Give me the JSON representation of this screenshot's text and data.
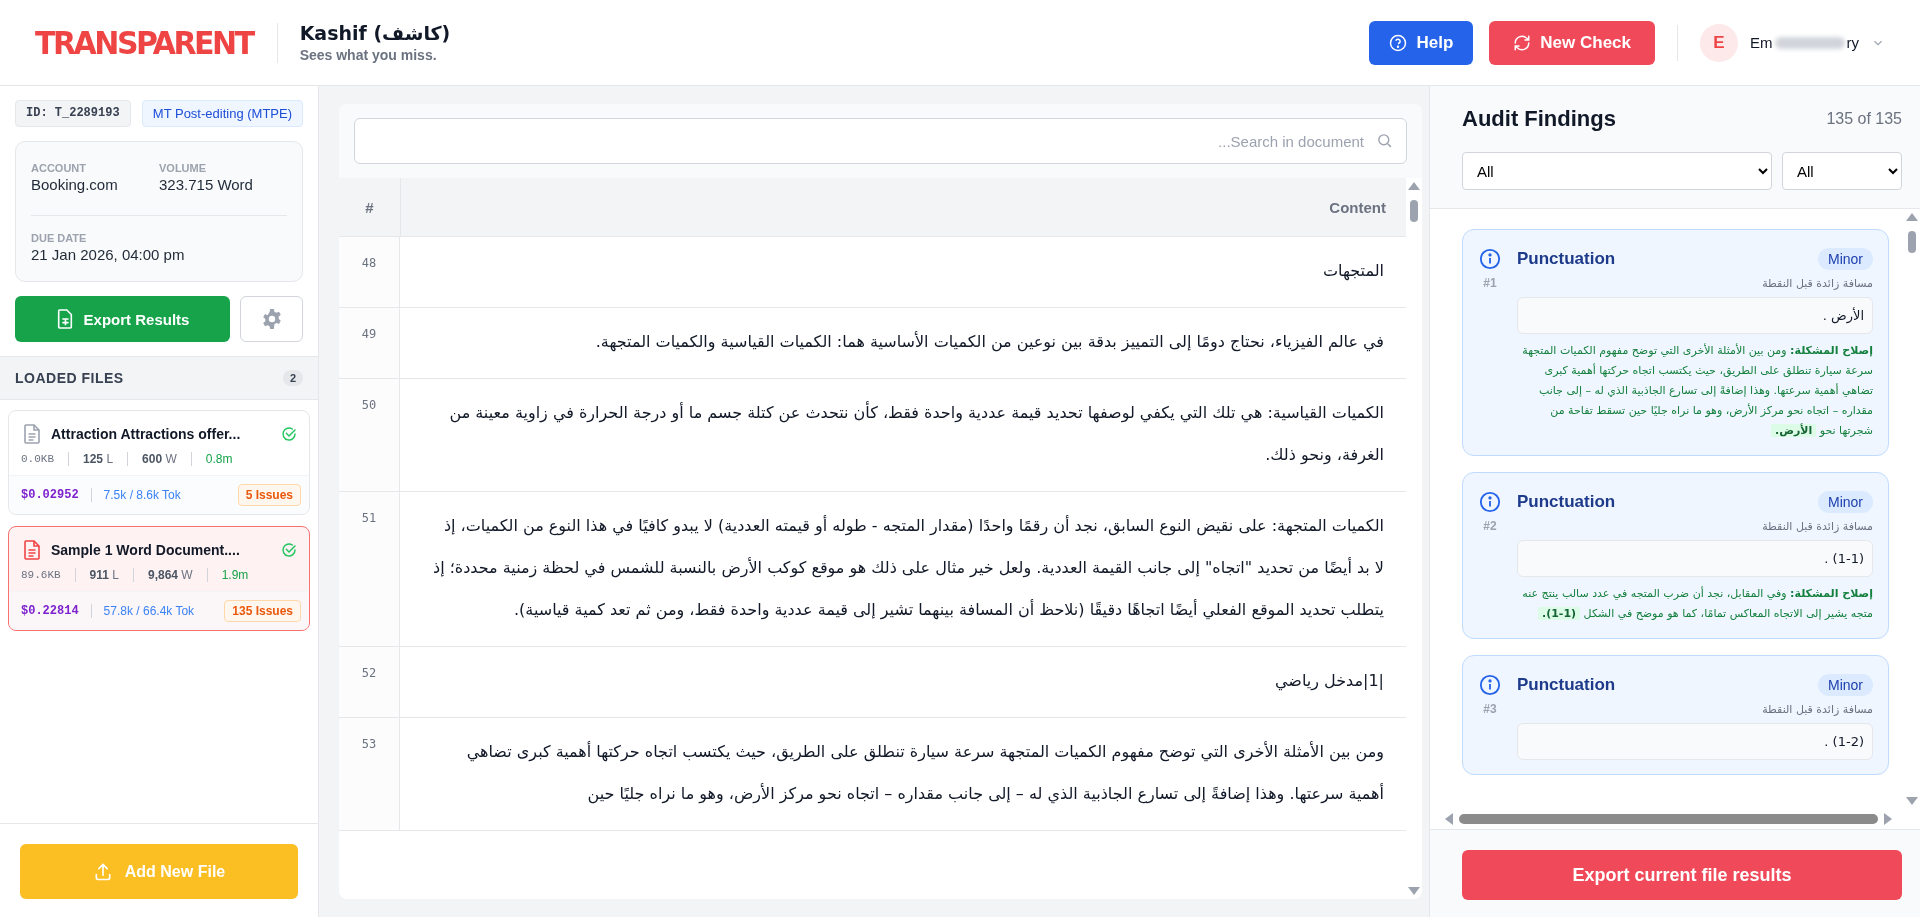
{
  "header": {
    "logo": "TRANSPARENT",
    "app_name": "Kashif (كاشف)",
    "tagline": "Sees what you miss.",
    "help_button": "Help",
    "new_check_button": "New Check",
    "user": {
      "initial": "E",
      "name_start": "Em",
      "name_end": "ry"
    }
  },
  "sidebar": {
    "id_tag": "ID: T_2289193",
    "mode_tag": "MT Post-editing (MTPE)",
    "account": {
      "label": "ACCOUNT",
      "value": "Booking.com"
    },
    "volume": {
      "label": "VOLUME",
      "value": "323.715 Word"
    },
    "due_date": {
      "label": "DUE DATE",
      "value": "21 Jan 2026, 04:00 pm"
    },
    "export_button": "Export Results",
    "files_heading": "LOADED FILES",
    "files_count": "2",
    "files": [
      {
        "name": "Attraction Attractions offer...",
        "selected": false,
        "complete": true,
        "size": "0.0KB",
        "lines": "125",
        "lines_unit": "L",
        "words": "600",
        "words_unit": "W",
        "time": "0.8m",
        "cost": "$0.02952",
        "tokens": "7.5k / 8.6k Tok",
        "issues": "5 Issues"
      },
      {
        "name": "Sample 1 Word Document....",
        "selected": true,
        "complete": true,
        "size": "89.6KB",
        "lines": "911",
        "lines_unit": "L",
        "words": "9,864",
        "words_unit": "W",
        "time": "1.9m",
        "cost": "$0.22814",
        "tokens": "57.8k / 66.4k Tok",
        "issues": "135 Issues"
      }
    ],
    "add_button": "Add New File"
  },
  "document": {
    "search": {
      "placeholder": "Search in document..."
    },
    "number_column": "#",
    "content_column": "Content",
    "rows": [
      {
        "number": "48",
        "text": "المتجهات"
      },
      {
        "number": "49",
        "text": "في عالم الفيزياء، نحتاج دومًا إلى التمييز بدقة بين نوعين من الكميات الأساسية هما: الكميات القياسية والكميات المتجهة."
      },
      {
        "number": "50",
        "text": "الكميات القياسية: هي تلك التي يكفي لوصفها تحديد قيمة عددية واحدة فقط، كأن نتحدث عن كتلة جسم ما أو درجة الحرارة في زاوية معينة من الغرفة، ونحو ذلك."
      },
      {
        "number": "51",
        "text": "الكميات المتجهة: على نقيض النوع السابق، نجد أن رقمًا واحدًا (مقدار المتجه - طوله أو قيمته العددية) لا يبدو كافيًا في هذا النوع من الكميات، إذ لا بد أيضًا من تحديد \"اتجاه\" إلى جانب القيمة العددية. ولعل خير مثال على ذلك هو موقع كوكب الأرض بالنسبة للشمس في لحظة زمنية محددة؛ إذ يتطلب تحديد الموقع الفعلي أيضًا اتجاهًا دقيقًا (نلاحظ أن المسافة بينهما تشير إلى قيمة عددية واحدة فقط، ومن ثم تعد كمية قياسية)."
      },
      {
        "number": "52",
        "text": "|1|مدخل رياضي"
      },
      {
        "number": "53",
        "text": "ومن بين الأمثلة الأخرى التي توضح مفهوم الكميات المتجهة سرعة سيارة تنطلق على الطريق، حيث يكتسب اتجاه حركتها أهمية كبرى تضاهي أهمية سرعتها. وهذا إضافةً إلى تسارع الجاذبية الذي له – إلى جانب مقداره – اتجاه نحو مركز الأرض، وهو ما نراه جليًا حين"
      }
    ]
  },
  "findings": {
    "title": "Audit Findings",
    "count": "135 of 135",
    "category_filter": "All",
    "severity_filter": "All",
    "items": [
      {
        "category": "Punctuation",
        "severity": "Minor",
        "number": "#1",
        "description": "مسافة زائدة قبل النقطة",
        "snippet": "الأرض .",
        "fix_label": "إصلاح المشكلة:",
        "fix_text": "ومن بين الأمثلة الأخرى التي توضح مفهوم الكميات المتجهة سرعة سيارة تنطلق على الطريق، حيث يكتسب اتجاه حركتها أهمية كبرى تضاهي أهمية سرعتها. وهذا إضافةً إلى تسارع الجاذبية الذي له – إلى جانب مقداره – اتجاه نحو مركز الأرض، وهو ما نراه جليًا حين تسقط تفاحة من شجرتها نحو",
        "fix_highlight": "الأرض."
      },
      {
        "category": "Punctuation",
        "severity": "Minor",
        "number": "#2",
        "description": "مسافة زائدة قبل النقطة",
        "snippet": "(1-1) .",
        "fix_label": "إصلاح المشكلة:",
        "fix_text": "وفي المقابل، نجد أن ضرب المتجه في عدد سالب ينتج عنه متجه يشير إلى الاتجاه المعاكس تمامًا، كما هو موضح في الشكل",
        "fix_highlight": "(1-1)."
      },
      {
        "category": "Punctuation",
        "severity": "Minor",
        "number": "#3",
        "description": "مسافة زائدة قبل النقطة",
        "snippet": "(1-2) ."
      }
    ],
    "export_button": "Export current file results"
  }
}
